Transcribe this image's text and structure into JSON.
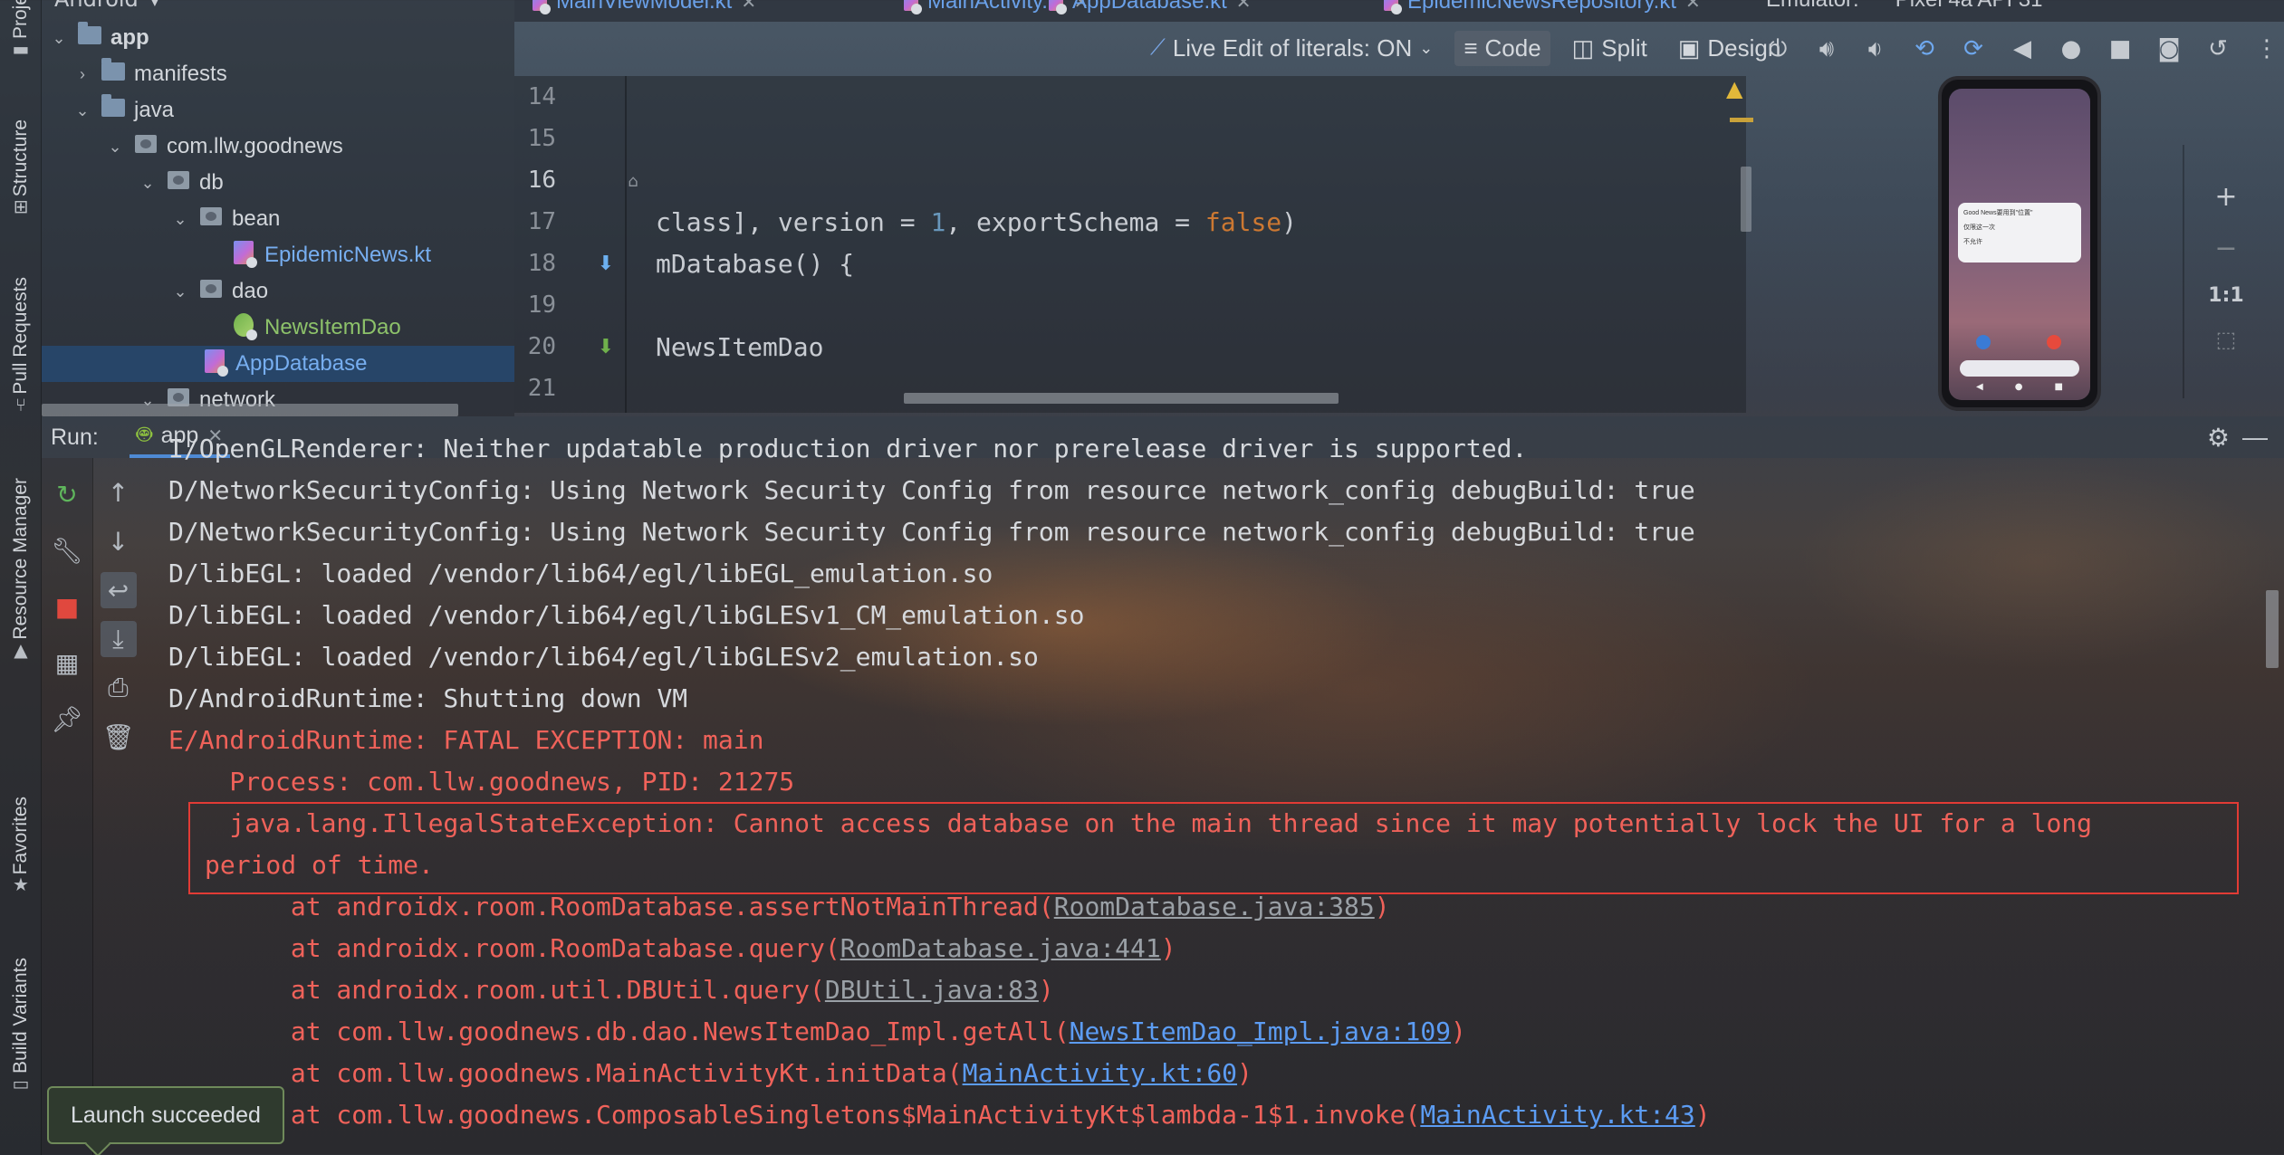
{
  "left_stripe": {
    "project_label": "Proje",
    "structure_label": "Structure",
    "pull_requests_label": "Pull Requests",
    "resource_manager_label": "Resource Manager",
    "favorites_label": "Favorites",
    "build_variants_label": "Build Variants"
  },
  "project_tree": {
    "top_label": "Android",
    "items": [
      {
        "label": "app",
        "icon": "folder-icon"
      },
      {
        "label": "manifests",
        "icon": "folder-icon"
      },
      {
        "label": "java",
        "icon": "folder-icon"
      },
      {
        "label": "com.llw.goodnews",
        "icon": "package-icon"
      },
      {
        "label": "db",
        "icon": "package-icon"
      },
      {
        "label": "bean",
        "icon": "package-icon"
      },
      {
        "label": "EpidemicNews.kt",
        "icon": "kotlin-file-icon"
      },
      {
        "label": "dao",
        "icon": "package-icon"
      },
      {
        "label": "NewsItemDao",
        "icon": "kotlin-interface-icon"
      },
      {
        "label": "AppDatabase",
        "icon": "kotlin-class-icon"
      },
      {
        "label": "network",
        "icon": "package-icon"
      }
    ]
  },
  "tabs": [
    {
      "label": "MainViewModel.kt"
    },
    {
      "label": "MainActivity.kt"
    },
    {
      "label": "AppDatabase.kt"
    },
    {
      "label": "EpidemicNewsRepository.kt"
    }
  ],
  "editor_toolbar": {
    "live_edit": "Live Edit of literals: ON",
    "code": "Code",
    "split": "Split",
    "design": "Design"
  },
  "editor": {
    "lines": [
      {
        "n": "14",
        "code": ""
      },
      {
        "n": "15",
        "code": ""
      },
      {
        "n": "16",
        "code": ""
      },
      {
        "n": "17",
        "code_pre": "class], version = ",
        "code_num": "1",
        "code_mid": ", exportSchema = ",
        "code_kw": "false",
        "code_post": ")"
      },
      {
        "n": "18",
        "code": "mDatabase() {"
      },
      {
        "n": "19",
        "code": ""
      },
      {
        "n": "20",
        "code": "NewsItemDao"
      },
      {
        "n": "21",
        "code": ""
      }
    ]
  },
  "emulator": {
    "title": "Emulator:",
    "device": "Pixel 4a API 31",
    "zoom_ratio": "1:1",
    "dialog_title": "Good News要用到\"位置\"",
    "dialog_option1": "仅限这一次",
    "dialog_option2": "不允许"
  },
  "run_panel": {
    "label": "Run:",
    "tab": "app"
  },
  "console": {
    "lines": [
      {
        "text": "I/OpenGLRenderer: Neither updatable production driver nor prerelease driver is supported.",
        "type": "info"
      },
      {
        "text": "D/NetworkSecurityConfig: Using Network Security Config from resource network_config debugBuild: true",
        "type": "info"
      },
      {
        "text": "D/NetworkSecurityConfig: Using Network Security Config from resource network_config debugBuild: true",
        "type": "info"
      },
      {
        "text": "D/libEGL: loaded /vendor/lib64/egl/libEGL_emulation.so",
        "type": "info"
      },
      {
        "text": "D/libEGL: loaded /vendor/lib64/egl/libGLESv1_CM_emulation.so",
        "type": "info"
      },
      {
        "text": "D/libEGL: loaded /vendor/lib64/egl/libGLESv2_emulation.so",
        "type": "info"
      },
      {
        "text": "D/AndroidRuntime: Shutting down VM",
        "type": "info"
      },
      {
        "text": "E/AndroidRuntime: FATAL EXCEPTION: main",
        "type": "error"
      },
      {
        "text": "    Process: com.llw.goodnews, PID: 21275",
        "type": "error"
      },
      {
        "text": "    java.lang.IllegalStateException: Cannot access database on the main thread since it may potentially lock the UI for a long",
        "type": "error"
      },
      {
        "text": "period of time.",
        "type": "error"
      }
    ],
    "stack": [
      {
        "prefix": "        at androidx.room.RoomDatabase.assertNotMainThread(",
        "link": "RoomDatabase.java:385",
        "suffix": ")",
        "link_style": "grey"
      },
      {
        "prefix": "        at androidx.room.RoomDatabase.query(",
        "link": "RoomDatabase.java:441",
        "suffix": ")",
        "link_style": "grey"
      },
      {
        "prefix": "        at androidx.room.util.DBUtil.query(",
        "link": "DBUtil.java:83",
        "suffix": ")",
        "link_style": "grey"
      },
      {
        "prefix": "        at com.llw.goodnews.db.dao.NewsItemDao_Impl.getAll(",
        "link": "NewsItemDao_Impl.java:109",
        "suffix": ")",
        "link_style": "blue"
      },
      {
        "prefix": "        at com.llw.goodnews.MainActivityKt.initData(",
        "link": "MainActivity.kt:60",
        "suffix": ")",
        "link_style": "blue"
      },
      {
        "prefix": "        at com.llw.goodnews.ComposableSingletons$MainActivityKt$lambda-1$1.invoke(",
        "link": "MainActivity.kt:43",
        "suffix": ")",
        "link_style": "blue"
      }
    ]
  },
  "toast": {
    "text": "Launch succeeded"
  },
  "colors": {
    "error": "#f0625a",
    "error_box": "#e23b35",
    "link": "#5c9cf3",
    "accent": "#4e8ad4"
  }
}
